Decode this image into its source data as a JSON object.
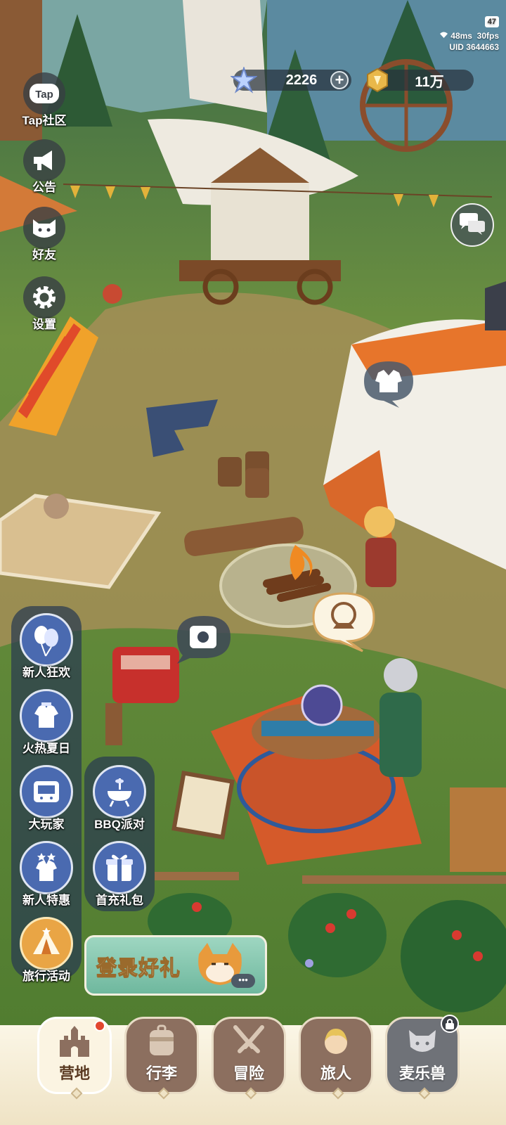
{
  "status": {
    "battery": "47",
    "ping": "48ms",
    "fps": "30fps",
    "uid": "UID 3644663"
  },
  "currency": {
    "gems": {
      "value": "2226",
      "icon": "star-gem-icon"
    },
    "coins": {
      "value": "11万",
      "icon": "gold-coin-icon"
    }
  },
  "top_menu": [
    {
      "label": "Tap社区",
      "icon": "tap-logo-icon"
    },
    {
      "label": "公告",
      "icon": "megaphone-icon"
    },
    {
      "label": "好友",
      "icon": "cat-face-icon"
    },
    {
      "label": "设置",
      "icon": "gear-icon"
    }
  ],
  "events_left": [
    {
      "label": "新人狂欢",
      "icon": "balloons-icon"
    },
    {
      "label": "火热夏日",
      "icon": "summer-shirt-icon"
    },
    {
      "label": "大玩家",
      "icon": "arcade-icon"
    },
    {
      "label": "新人特惠",
      "icon": "stars-shirt-icon"
    },
    {
      "label": "旅行活动",
      "icon": "tent-icon"
    }
  ],
  "events_right": [
    {
      "label": "BBQ派对",
      "icon": "grill-icon"
    },
    {
      "label": "首充礼包",
      "icon": "gift-icon"
    }
  ],
  "login_banner": {
    "text": "登录好礼",
    "more": "•••"
  },
  "bottom_nav": [
    {
      "label": "营地",
      "icon": "castle-icon",
      "active": true,
      "badge": true
    },
    {
      "label": "行李",
      "icon": "backpack-icon",
      "active": false
    },
    {
      "label": "冒险",
      "icon": "crossed-swords-icon",
      "active": false
    },
    {
      "label": "旅人",
      "icon": "hero-face-icon",
      "active": false
    },
    {
      "label": "麦乐兽",
      "icon": "pet-face-icon",
      "active": false,
      "lock": true
    }
  ],
  "colors": {
    "nav_inactive": "#8c6f5f",
    "nav_active": "#fbf4e2",
    "event_circle": "#4a6ab0",
    "banner": "#9ed6c1"
  }
}
